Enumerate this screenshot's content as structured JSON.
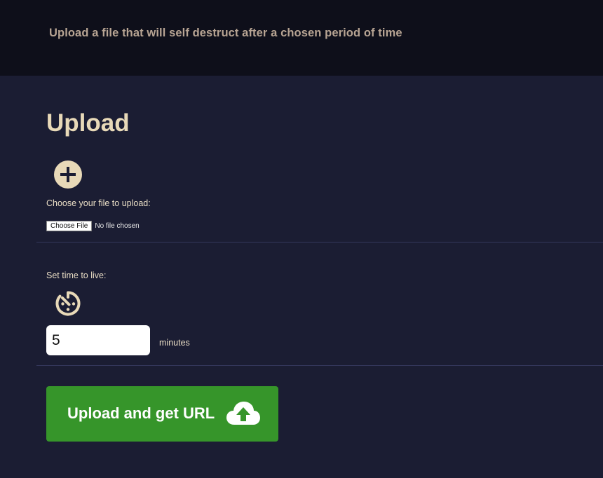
{
  "header": {
    "tagline": "Upload a file that will self destruct after a chosen period of time"
  },
  "upload": {
    "title": "Upload",
    "add_icon": "plus-circle-icon",
    "choose_label": "Choose your file to upload:",
    "file_button_label": "Choose File",
    "file_status": "No file chosen"
  },
  "ttl": {
    "label": "Set time to live:",
    "icon": "timer-icon",
    "value": "5",
    "unit": "minutes"
  },
  "submit": {
    "label": "Upload and get URL",
    "icon": "cloud-upload-icon",
    "color": "#36952a"
  },
  "colors": {
    "background": "#1b1d33",
    "header_background": "#0e0f1a",
    "title": "#e8d9b8",
    "tagline": "#b7a493"
  }
}
